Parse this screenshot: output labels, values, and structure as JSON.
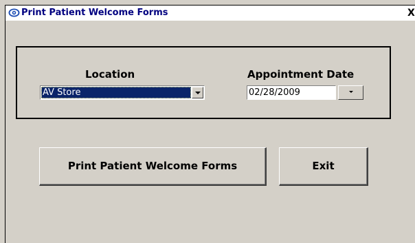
{
  "window": {
    "title": "Print Patient Welcome Forms",
    "close_label": "X"
  },
  "form": {
    "location_label": "Location",
    "location_value": "AV Store",
    "date_label": "Appointment Date",
    "date_value": "02/28/2009"
  },
  "buttons": {
    "print_label": "Print Patient Welcome Forms",
    "exit_label": "Exit"
  },
  "icons": {
    "app": "eye-icon",
    "combo_dropdown": "chevron-down-icon",
    "date_dropdown": "chevron-down-icon"
  },
  "colors": {
    "title_text": "#000080",
    "selection": "#0a246a",
    "face": "#d4d0c8"
  }
}
